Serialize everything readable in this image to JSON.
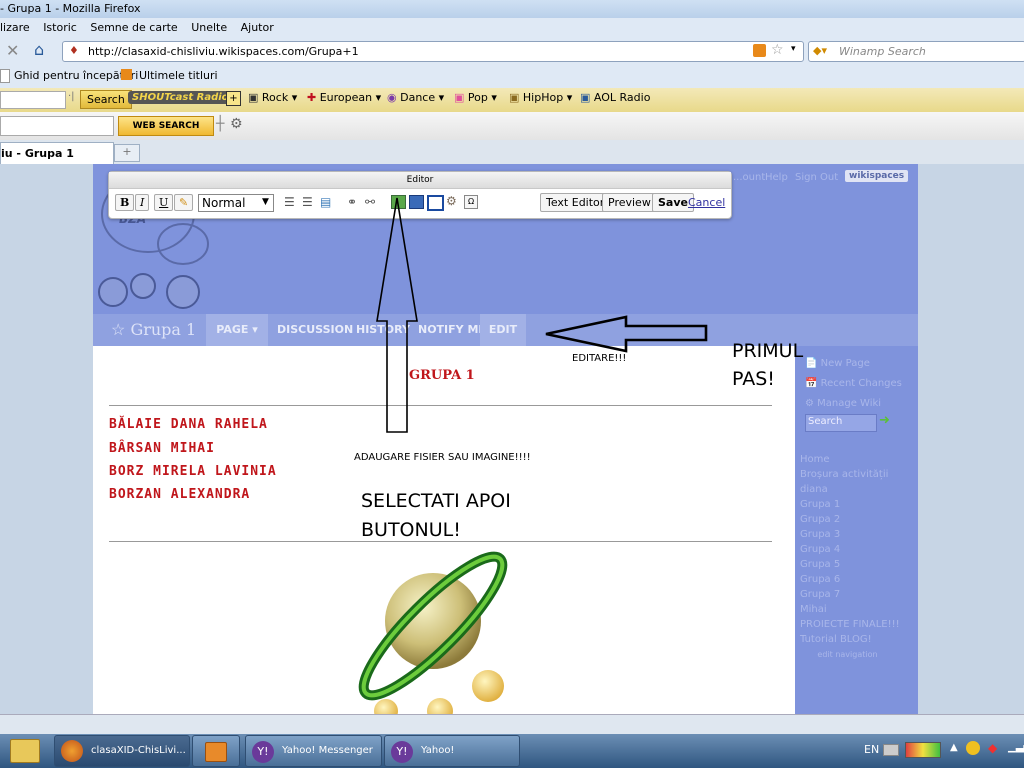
{
  "window": {
    "title": "- Grupa 1 - Mozilla Firefox"
  },
  "menu": [
    "lizare",
    "Istoric",
    "Semne de carte",
    "Unelte",
    "Ajutor"
  ],
  "nav": {
    "url": "http://clasaxid-chisliviu.wikispaces.com/Grupa+1",
    "search_placeholder": "Winamp Search"
  },
  "bookmarks": [
    "Ghid pentru începători",
    "Ultimele titluri"
  ],
  "toolbar1": {
    "search_button": "Search",
    "radio": "SHOUTcast Radio",
    "stations": [
      "Rock",
      "European",
      "Dance",
      "Pop",
      "HipHop",
      "AOL Radio"
    ]
  },
  "toolbar2": {
    "web_search": "WEB SEARCH"
  },
  "tab": {
    "label": "iu - Grupa 1"
  },
  "editor": {
    "title": "Editor",
    "format_buttons": [
      "B",
      "I",
      "U"
    ],
    "style_select": "Normal",
    "buttons": {
      "text_editor": "Text Editor",
      "preview": "Preview",
      "save": "Save",
      "cancel": "Cancel"
    }
  },
  "wiki": {
    "logo_text": "wikispaces",
    "top_links": [
      "...ount",
      "Help",
      "Sign Out"
    ],
    "page_title": "Grupa 1",
    "tabs": [
      "PAGE",
      "DISCUSSION",
      "HISTORY",
      "NOTIFY ME",
      "EDIT"
    ],
    "heading": "GRUPA 1",
    "names": [
      "BĂLAIE DANA RAHELA",
      "BÂRSAN MIHAI",
      "BORZ MIRELA LAVINIA",
      "BORZAN ALEXANDRA"
    ],
    "sidebar_actions": [
      "New Page",
      "Recent Changes",
      "Manage Wiki"
    ],
    "search_label": "Search",
    "sidebar_links": [
      "Home",
      "Broșura activității",
      "diana",
      "Grupa 1",
      "Grupa 2",
      "Grupa 3",
      "Grupa 4",
      "Grupa 5",
      "Grupa 6",
      "Grupa 7",
      "Mihai",
      "PROIECTE FINALE!!!",
      "Tutorial BLOG!"
    ],
    "edit_navigation": "edit navigation"
  },
  "annotations": {
    "editare": "EDITARE!!!",
    "primul_pas": "PRIMUL PAS!",
    "adaugare": "ADAUGARE FISIER SAU IMAGINE!!!!",
    "selectati": "SELECTATI APOI BUTONUL!"
  },
  "taskbar": {
    "items": [
      "clasaXID-ChisLivi...",
      "Yahoo! Messenger",
      "Yahoo!"
    ],
    "lang": "EN"
  },
  "colors": {
    "wiki_header": "#7f93dc",
    "wiki_nav": "#8fa1e0",
    "name_red": "#c0161b",
    "taskbar": "#3d6690"
  }
}
